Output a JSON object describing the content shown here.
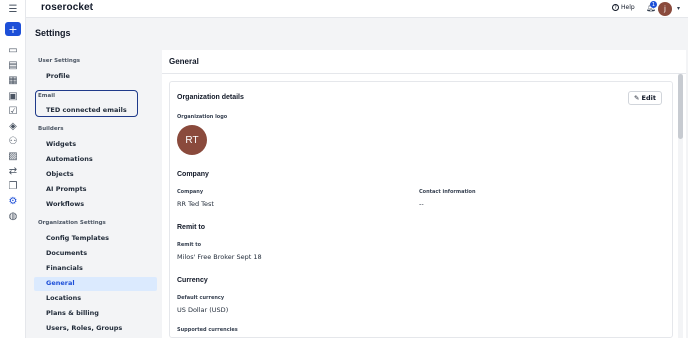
{
  "app": {
    "brand": "roserocket"
  },
  "topbar": {
    "help_label": "Help",
    "notification_count": "1",
    "avatar_initial": "j"
  },
  "page": {
    "title": "Settings"
  },
  "nav": {
    "sections": [
      {
        "title": "User Settings",
        "items": [
          "Profile"
        ]
      },
      {
        "title": "Email",
        "items": [
          "TED connected emails"
        ]
      },
      {
        "title": "Builders",
        "items": [
          "Widgets",
          "Automations",
          "Objects",
          "AI Prompts",
          "Workflows"
        ]
      },
      {
        "title": "Organization Settings",
        "items": [
          "Config Templates",
          "Documents",
          "Financials",
          "General",
          "Locations",
          "Plans & billing",
          "Users, Roles, Groups"
        ]
      }
    ],
    "selected": "General"
  },
  "main": {
    "title": "General",
    "org_details": {
      "title": "Organization details",
      "edit_label": "Edit",
      "logo_label": "Organization logo",
      "logo_initials": "RT"
    },
    "company": {
      "title": "Company",
      "company_label": "Company",
      "company_value": "RR Ted Test",
      "contact_label": "Contact information",
      "contact_value": "--"
    },
    "remit_to": {
      "title": "Remit to",
      "label": "Remit to",
      "value": "Milos' Free Broker Sept 18"
    },
    "currency": {
      "title": "Currency",
      "default_label": "Default currency",
      "default_value": "US Dollar (USD)",
      "supported_label": "Supported currencies"
    }
  },
  "colors": {
    "accent": "#1d4fd8",
    "avatar": "#8a4a3c",
    "selected_bg": "#dbeafe"
  },
  "icons": [
    "menu-icon",
    "plus-icon",
    "inbox-icon",
    "clipboard-icon",
    "orders-icon",
    "calendar-icon",
    "tasks-icon",
    "wallet-icon",
    "people-icon",
    "chart-icon",
    "transfer-icon",
    "documents-icon",
    "settings-icon",
    "globe-icon"
  ]
}
